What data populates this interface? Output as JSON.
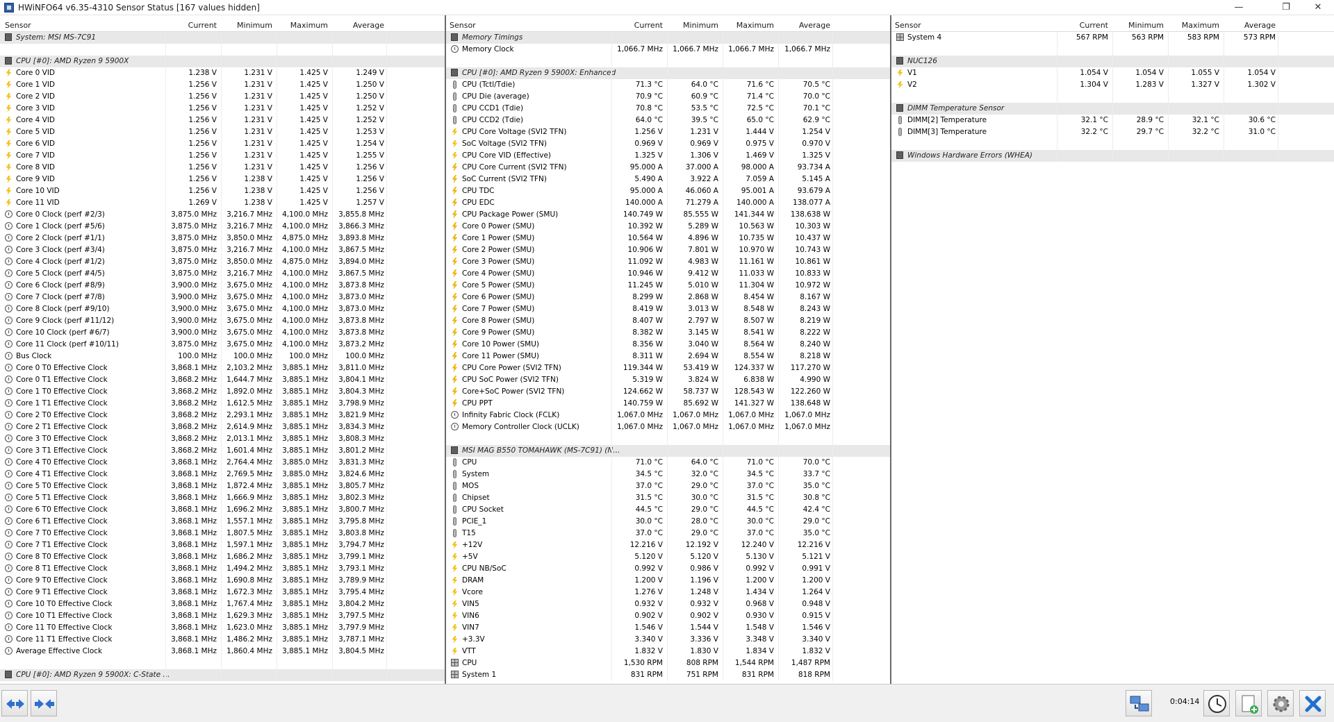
{
  "window": {
    "title": "HWiNFO64 v6.35-4310 Sensor Status [167 values hidden]",
    "min_glyph": "—",
    "restore_glyph": "❐",
    "close_glyph": "✕"
  },
  "columns": {
    "sensor": "Sensor",
    "current": "Current",
    "minimum": "Minimum",
    "maximum": "Maximum",
    "average": "Average"
  },
  "panel1": [
    {
      "g": "System: MSI MS-7C91",
      "i": "chip"
    },
    {
      "blank": true
    },
    {
      "g": "CPU [#0]: AMD Ryzen 9 5900X",
      "i": "chip"
    },
    {
      "n": "Core 0 VID",
      "i": "volt",
      "c": "1.238 V",
      "mn": "1.231 V",
      "mx": "1.425 V",
      "av": "1.249 V"
    },
    {
      "n": "Core 1 VID",
      "i": "volt",
      "c": "1.256 V",
      "mn": "1.231 V",
      "mx": "1.425 V",
      "av": "1.250 V"
    },
    {
      "n": "Core 2 VID",
      "i": "volt",
      "c": "1.256 V",
      "mn": "1.231 V",
      "mx": "1.425 V",
      "av": "1.250 V"
    },
    {
      "n": "Core 3 VID",
      "i": "volt",
      "c": "1.256 V",
      "mn": "1.231 V",
      "mx": "1.425 V",
      "av": "1.252 V"
    },
    {
      "n": "Core 4 VID",
      "i": "volt",
      "c": "1.256 V",
      "mn": "1.231 V",
      "mx": "1.425 V",
      "av": "1.252 V"
    },
    {
      "n": "Core 5 VID",
      "i": "volt",
      "c": "1.256 V",
      "mn": "1.231 V",
      "mx": "1.425 V",
      "av": "1.253 V"
    },
    {
      "n": "Core 6 VID",
      "i": "volt",
      "c": "1.256 V",
      "mn": "1.231 V",
      "mx": "1.425 V",
      "av": "1.254 V"
    },
    {
      "n": "Core 7 VID",
      "i": "volt",
      "c": "1.256 V",
      "mn": "1.231 V",
      "mx": "1.425 V",
      "av": "1.255 V"
    },
    {
      "n": "Core 8 VID",
      "i": "volt",
      "c": "1.256 V",
      "mn": "1.231 V",
      "mx": "1.425 V",
      "av": "1.256 V"
    },
    {
      "n": "Core 9 VID",
      "i": "volt",
      "c": "1.256 V",
      "mn": "1.238 V",
      "mx": "1.425 V",
      "av": "1.256 V"
    },
    {
      "n": "Core 10 VID",
      "i": "volt",
      "c": "1.256 V",
      "mn": "1.238 V",
      "mx": "1.425 V",
      "av": "1.256 V"
    },
    {
      "n": "Core 11 VID",
      "i": "volt",
      "c": "1.269 V",
      "mn": "1.238 V",
      "mx": "1.425 V",
      "av": "1.257 V"
    },
    {
      "n": "Core 0 Clock (perf #2/3)",
      "i": "clock",
      "c": "3,875.0 MHz",
      "mn": "3,216.7 MHz",
      "mx": "4,100.0 MHz",
      "av": "3,855.8 MHz"
    },
    {
      "n": "Core 1 Clock (perf #5/6)",
      "i": "clock",
      "c": "3,875.0 MHz",
      "mn": "3,216.7 MHz",
      "mx": "4,100.0 MHz",
      "av": "3,866.3 MHz"
    },
    {
      "n": "Core 2 Clock (perf #1/1)",
      "i": "clock",
      "c": "3,875.0 MHz",
      "mn": "3,850.0 MHz",
      "mx": "4,875.0 MHz",
      "av": "3,893.8 MHz"
    },
    {
      "n": "Core 3 Clock (perf #3/4)",
      "i": "clock",
      "c": "3,875.0 MHz",
      "mn": "3,216.7 MHz",
      "mx": "4,100.0 MHz",
      "av": "3,867.5 MHz"
    },
    {
      "n": "Core 4 Clock (perf #1/2)",
      "i": "clock",
      "c": "3,875.0 MHz",
      "mn": "3,850.0 MHz",
      "mx": "4,875.0 MHz",
      "av": "3,894.0 MHz"
    },
    {
      "n": "Core 5 Clock (perf #4/5)",
      "i": "clock",
      "c": "3,875.0 MHz",
      "mn": "3,216.7 MHz",
      "mx": "4,100.0 MHz",
      "av": "3,867.5 MHz"
    },
    {
      "n": "Core 6 Clock (perf #8/9)",
      "i": "clock",
      "c": "3,900.0 MHz",
      "mn": "3,675.0 MHz",
      "mx": "4,100.0 MHz",
      "av": "3,873.8 MHz"
    },
    {
      "n": "Core 7 Clock (perf #7/8)",
      "i": "clock",
      "c": "3,900.0 MHz",
      "mn": "3,675.0 MHz",
      "mx": "4,100.0 MHz",
      "av": "3,873.0 MHz"
    },
    {
      "n": "Core 8 Clock (perf #9/10)",
      "i": "clock",
      "c": "3,900.0 MHz",
      "mn": "3,675.0 MHz",
      "mx": "4,100.0 MHz",
      "av": "3,873.0 MHz"
    },
    {
      "n": "Core 9 Clock (perf #11/12)",
      "i": "clock",
      "c": "3,900.0 MHz",
      "mn": "3,675.0 MHz",
      "mx": "4,100.0 MHz",
      "av": "3,873.8 MHz"
    },
    {
      "n": "Core 10 Clock (perf #6/7)",
      "i": "clock",
      "c": "3,900.0 MHz",
      "mn": "3,675.0 MHz",
      "mx": "4,100.0 MHz",
      "av": "3,873.8 MHz"
    },
    {
      "n": "Core 11 Clock (perf #10/11)",
      "i": "clock",
      "c": "3,875.0 MHz",
      "mn": "3,675.0 MHz",
      "mx": "4,100.0 MHz",
      "av": "3,873.2 MHz"
    },
    {
      "n": "Bus Clock",
      "i": "clock",
      "c": "100.0 MHz",
      "mn": "100.0 MHz",
      "mx": "100.0 MHz",
      "av": "100.0 MHz"
    },
    {
      "n": "Core 0 T0 Effective Clock",
      "i": "clock",
      "c": "3,868.1 MHz",
      "mn": "2,103.2 MHz",
      "mx": "3,885.1 MHz",
      "av": "3,811.0 MHz"
    },
    {
      "n": "Core 0 T1 Effective Clock",
      "i": "clock",
      "c": "3,868.2 MHz",
      "mn": "1,644.7 MHz",
      "mx": "3,885.1 MHz",
      "av": "3,804.1 MHz"
    },
    {
      "n": "Core 1 T0 Effective Clock",
      "i": "clock",
      "c": "3,868.2 MHz",
      "mn": "1,892.0 MHz",
      "mx": "3,885.1 MHz",
      "av": "3,804.3 MHz"
    },
    {
      "n": "Core 1 T1 Effective Clock",
      "i": "clock",
      "c": "3,868.2 MHz",
      "mn": "1,612.5 MHz",
      "mx": "3,885.1 MHz",
      "av": "3,798.9 MHz"
    },
    {
      "n": "Core 2 T0 Effective Clock",
      "i": "clock",
      "c": "3,868.2 MHz",
      "mn": "2,293.1 MHz",
      "mx": "3,885.1 MHz",
      "av": "3,821.9 MHz"
    },
    {
      "n": "Core 2 T1 Effective Clock",
      "i": "clock",
      "c": "3,868.2 MHz",
      "mn": "2,614.9 MHz",
      "mx": "3,885.1 MHz",
      "av": "3,834.3 MHz"
    },
    {
      "n": "Core 3 T0 Effective Clock",
      "i": "clock",
      "c": "3,868.2 MHz",
      "mn": "2,013.1 MHz",
      "mx": "3,885.1 MHz",
      "av": "3,808.3 MHz"
    },
    {
      "n": "Core 3 T1 Effective Clock",
      "i": "clock",
      "c": "3,868.2 MHz",
      "mn": "1,601.4 MHz",
      "mx": "3,885.1 MHz",
      "av": "3,801.2 MHz"
    },
    {
      "n": "Core 4 T0 Effective Clock",
      "i": "clock",
      "c": "3,868.1 MHz",
      "mn": "2,764.4 MHz",
      "mx": "3,885.0 MHz",
      "av": "3,831.3 MHz"
    },
    {
      "n": "Core 4 T1 Effective Clock",
      "i": "clock",
      "c": "3,868.1 MHz",
      "mn": "2,769.5 MHz",
      "mx": "3,885.0 MHz",
      "av": "3,824.6 MHz"
    },
    {
      "n": "Core 5 T0 Effective Clock",
      "i": "clock",
      "c": "3,868.1 MHz",
      "mn": "1,872.4 MHz",
      "mx": "3,885.1 MHz",
      "av": "3,805.7 MHz"
    },
    {
      "n": "Core 5 T1 Effective Clock",
      "i": "clock",
      "c": "3,868.1 MHz",
      "mn": "1,666.9 MHz",
      "mx": "3,885.1 MHz",
      "av": "3,802.3 MHz"
    },
    {
      "n": "Core 6 T0 Effective Clock",
      "i": "clock",
      "c": "3,868.1 MHz",
      "mn": "1,696.2 MHz",
      "mx": "3,885.1 MHz",
      "av": "3,800.7 MHz"
    },
    {
      "n": "Core 6 T1 Effective Clock",
      "i": "clock",
      "c": "3,868.1 MHz",
      "mn": "1,557.1 MHz",
      "mx": "3,885.1 MHz",
      "av": "3,795.8 MHz"
    },
    {
      "n": "Core 7 T0 Effective Clock",
      "i": "clock",
      "c": "3,868.1 MHz",
      "mn": "1,807.5 MHz",
      "mx": "3,885.1 MHz",
      "av": "3,803.8 MHz"
    },
    {
      "n": "Core 7 T1 Effective Clock",
      "i": "clock",
      "c": "3,868.1 MHz",
      "mn": "1,597.1 MHz",
      "mx": "3,885.1 MHz",
      "av": "3,794.7 MHz"
    },
    {
      "n": "Core 8 T0 Effective Clock",
      "i": "clock",
      "c": "3,868.1 MHz",
      "mn": "1,686.2 MHz",
      "mx": "3,885.1 MHz",
      "av": "3,799.1 MHz"
    },
    {
      "n": "Core 8 T1 Effective Clock",
      "i": "clock",
      "c": "3,868.1 MHz",
      "mn": "1,494.2 MHz",
      "mx": "3,885.1 MHz",
      "av": "3,793.1 MHz"
    },
    {
      "n": "Core 9 T0 Effective Clock",
      "i": "clock",
      "c": "3,868.1 MHz",
      "mn": "1,690.8 MHz",
      "mx": "3,885.1 MHz",
      "av": "3,789.9 MHz"
    },
    {
      "n": "Core 9 T1 Effective Clock",
      "i": "clock",
      "c": "3,868.1 MHz",
      "mn": "1,672.3 MHz",
      "mx": "3,885.1 MHz",
      "av": "3,795.4 MHz"
    },
    {
      "n": "Core 10 T0 Effective Clock",
      "i": "clock",
      "c": "3,868.1 MHz",
      "mn": "1,767.4 MHz",
      "mx": "3,885.1 MHz",
      "av": "3,804.2 MHz"
    },
    {
      "n": "Core 10 T1 Effective Clock",
      "i": "clock",
      "c": "3,868.1 MHz",
      "mn": "1,629.3 MHz",
      "mx": "3,885.1 MHz",
      "av": "3,797.5 MHz"
    },
    {
      "n": "Core 11 T0 Effective Clock",
      "i": "clock",
      "c": "3,868.1 MHz",
      "mn": "1,623.0 MHz",
      "mx": "3,885.1 MHz",
      "av": "3,797.9 MHz"
    },
    {
      "n": "Core 11 T1 Effective Clock",
      "i": "clock",
      "c": "3,868.1 MHz",
      "mn": "1,486.2 MHz",
      "mx": "3,885.1 MHz",
      "av": "3,787.1 MHz"
    },
    {
      "n": "Average Effective Clock",
      "i": "clock",
      "c": "3,868.1 MHz",
      "mn": "1,860.4 MHz",
      "mx": "3,885.1 MHz",
      "av": "3,804.5 MHz"
    },
    {
      "blank": true
    },
    {
      "g": "CPU [#0]: AMD Ryzen 9 5900X: C-State ...",
      "i": "chip"
    }
  ],
  "panel2": [
    {
      "g": "Memory Timings",
      "i": "chip"
    },
    {
      "n": "Memory Clock",
      "i": "clock",
      "c": "1,066.7 MHz",
      "mn": "1,066.7 MHz",
      "mx": "1,066.7 MHz",
      "av": "1,066.7 MHz"
    },
    {
      "blank": true
    },
    {
      "g": "CPU [#0]: AMD Ryzen 9 5900X: Enhanced",
      "i": "chip"
    },
    {
      "n": "CPU (Tctl/Tdie)",
      "i": "temp",
      "c": "71.3 °C",
      "mn": "64.0 °C",
      "mx": "71.6 °C",
      "av": "70.5 °C"
    },
    {
      "n": "CPU Die (average)",
      "i": "temp",
      "c": "70.9 °C",
      "mn": "60.9 °C",
      "mx": "71.4 °C",
      "av": "70.0 °C"
    },
    {
      "n": "CPU CCD1 (Tdie)",
      "i": "temp",
      "c": "70.8 °C",
      "mn": "53.5 °C",
      "mx": "72.5 °C",
      "av": "70.1 °C"
    },
    {
      "n": "CPU CCD2 (Tdie)",
      "i": "temp",
      "c": "64.0 °C",
      "mn": "39.5 °C",
      "mx": "65.0 °C",
      "av": "62.9 °C"
    },
    {
      "n": "CPU Core Voltage (SVI2 TFN)",
      "i": "volt",
      "c": "1.256 V",
      "mn": "1.231 V",
      "mx": "1.444 V",
      "av": "1.254 V"
    },
    {
      "n": "SoC Voltage (SVI2 TFN)",
      "i": "volt",
      "c": "0.969 V",
      "mn": "0.969 V",
      "mx": "0.975 V",
      "av": "0.970 V"
    },
    {
      "n": "CPU Core VID (Effective)",
      "i": "volt",
      "c": "1.325 V",
      "mn": "1.306 V",
      "mx": "1.469 V",
      "av": "1.325 V"
    },
    {
      "n": "CPU Core Current (SVI2 TFN)",
      "i": "current",
      "c": "95.000 A",
      "mn": "37.000 A",
      "mx": "98.000 A",
      "av": "93.734 A"
    },
    {
      "n": "SoC Current (SVI2 TFN)",
      "i": "current",
      "c": "5.490 A",
      "mn": "3.922 A",
      "mx": "7.059 A",
      "av": "5.145 A"
    },
    {
      "n": "CPU TDC",
      "i": "current",
      "c": "95.000 A",
      "mn": "46.060 A",
      "mx": "95.001 A",
      "av": "93.679 A"
    },
    {
      "n": "CPU EDC",
      "i": "current",
      "c": "140.000 A",
      "mn": "71.279 A",
      "mx": "140.000 A",
      "av": "138.077 A"
    },
    {
      "n": "CPU Package Power (SMU)",
      "i": "power",
      "c": "140.749 W",
      "mn": "85.555 W",
      "mx": "141.344 W",
      "av": "138.638 W"
    },
    {
      "n": "Core 0 Power (SMU)",
      "i": "power",
      "c": "10.392 W",
      "mn": "5.289 W",
      "mx": "10.563 W",
      "av": "10.303 W"
    },
    {
      "n": "Core 1 Power (SMU)",
      "i": "power",
      "c": "10.564 W",
      "mn": "4.896 W",
      "mx": "10.735 W",
      "av": "10.437 W"
    },
    {
      "n": "Core 2 Power (SMU)",
      "i": "power",
      "c": "10.906 W",
      "mn": "7.801 W",
      "mx": "10.970 W",
      "av": "10.743 W"
    },
    {
      "n": "Core 3 Power (SMU)",
      "i": "power",
      "c": "11.092 W",
      "mn": "4.983 W",
      "mx": "11.161 W",
      "av": "10.861 W"
    },
    {
      "n": "Core 4 Power (SMU)",
      "i": "power",
      "c": "10.946 W",
      "mn": "9.412 W",
      "mx": "11.033 W",
      "av": "10.833 W"
    },
    {
      "n": "Core 5 Power (SMU)",
      "i": "power",
      "c": "11.245 W",
      "mn": "5.010 W",
      "mx": "11.304 W",
      "av": "10.972 W"
    },
    {
      "n": "Core 6 Power (SMU)",
      "i": "power",
      "c": "8.299 W",
      "mn": "2.868 W",
      "mx": "8.454 W",
      "av": "8.167 W"
    },
    {
      "n": "Core 7 Power (SMU)",
      "i": "power",
      "c": "8.419 W",
      "mn": "3.013 W",
      "mx": "8.548 W",
      "av": "8.243 W"
    },
    {
      "n": "Core 8 Power (SMU)",
      "i": "power",
      "c": "8.407 W",
      "mn": "2.797 W",
      "mx": "8.507 W",
      "av": "8.219 W"
    },
    {
      "n": "Core 9 Power (SMU)",
      "i": "power",
      "c": "8.382 W",
      "mn": "3.145 W",
      "mx": "8.541 W",
      "av": "8.222 W"
    },
    {
      "n": "Core 10 Power (SMU)",
      "i": "power",
      "c": "8.356 W",
      "mn": "3.040 W",
      "mx": "8.564 W",
      "av": "8.240 W"
    },
    {
      "n": "Core 11 Power (SMU)",
      "i": "power",
      "c": "8.311 W",
      "mn": "2.694 W",
      "mx": "8.554 W",
      "av": "8.218 W"
    },
    {
      "n": "CPU Core Power (SVI2 TFN)",
      "i": "power",
      "c": "119.344 W",
      "mn": "53.419 W",
      "mx": "124.337 W",
      "av": "117.270 W"
    },
    {
      "n": "CPU SoC Power (SVI2 TFN)",
      "i": "power",
      "c": "5.319 W",
      "mn": "3.824 W",
      "mx": "6.838 W",
      "av": "4.990 W"
    },
    {
      "n": "Core+SoC Power (SVI2 TFN)",
      "i": "power",
      "c": "124.662 W",
      "mn": "58.737 W",
      "mx": "128.543 W",
      "av": "122.260 W"
    },
    {
      "n": "CPU PPT",
      "i": "power",
      "c": "140.759 W",
      "mn": "85.692 W",
      "mx": "141.327 W",
      "av": "138.648 W"
    },
    {
      "n": "Infinity Fabric Clock (FCLK)",
      "i": "clock",
      "c": "1,067.0 MHz",
      "mn": "1,067.0 MHz",
      "mx": "1,067.0 MHz",
      "av": "1,067.0 MHz"
    },
    {
      "n": "Memory Controller Clock (UCLK)",
      "i": "clock",
      "c": "1,067.0 MHz",
      "mn": "1,067.0 MHz",
      "mx": "1,067.0 MHz",
      "av": "1,067.0 MHz"
    },
    {
      "blank": true
    },
    {
      "g": "MSI MAG B550 TOMAHAWK (MS-7C91) (N...",
      "i": "chip"
    },
    {
      "n": "CPU",
      "i": "temp",
      "c": "71.0 °C",
      "mn": "64.0 °C",
      "mx": "71.0 °C",
      "av": "70.0 °C"
    },
    {
      "n": "System",
      "i": "temp",
      "c": "34.5 °C",
      "mn": "32.0 °C",
      "mx": "34.5 °C",
      "av": "33.7 °C"
    },
    {
      "n": "MOS",
      "i": "temp",
      "c": "37.0 °C",
      "mn": "29.0 °C",
      "mx": "37.0 °C",
      "av": "35.0 °C"
    },
    {
      "n": "Chipset",
      "i": "temp",
      "c": "31.5 °C",
      "mn": "30.0 °C",
      "mx": "31.5 °C",
      "av": "30.8 °C"
    },
    {
      "n": "CPU Socket",
      "i": "temp",
      "c": "44.5 °C",
      "mn": "29.0 °C",
      "mx": "44.5 °C",
      "av": "42.4 °C"
    },
    {
      "n": "PCIE_1",
      "i": "temp",
      "c": "30.0 °C",
      "mn": "28.0 °C",
      "mx": "30.0 °C",
      "av": "29.0 °C"
    },
    {
      "n": "T15",
      "i": "temp",
      "c": "37.0 °C",
      "mn": "29.0 °C",
      "mx": "37.0 °C",
      "av": "35.0 °C"
    },
    {
      "n": "+12V",
      "i": "volt",
      "c": "12.216 V",
      "mn": "12.192 V",
      "mx": "12.240 V",
      "av": "12.216 V"
    },
    {
      "n": "+5V",
      "i": "volt",
      "c": "5.120 V",
      "mn": "5.120 V",
      "mx": "5.130 V",
      "av": "5.121 V"
    },
    {
      "n": "CPU NB/SoC",
      "i": "volt",
      "c": "0.992 V",
      "mn": "0.986 V",
      "mx": "0.992 V",
      "av": "0.991 V"
    },
    {
      "n": "DRAM",
      "i": "volt",
      "c": "1.200 V",
      "mn": "1.196 V",
      "mx": "1.200 V",
      "av": "1.200 V"
    },
    {
      "n": "Vcore",
      "i": "volt",
      "c": "1.276 V",
      "mn": "1.248 V",
      "mx": "1.434 V",
      "av": "1.264 V"
    },
    {
      "n": "VIN5",
      "i": "volt",
      "c": "0.932 V",
      "mn": "0.932 V",
      "mx": "0.968 V",
      "av": "0.948 V"
    },
    {
      "n": "VIN6",
      "i": "volt",
      "c": "0.902 V",
      "mn": "0.902 V",
      "mx": "0.930 V",
      "av": "0.915 V"
    },
    {
      "n": "VIN7",
      "i": "volt",
      "c": "1.546 V",
      "mn": "1.544 V",
      "mx": "1.548 V",
      "av": "1.546 V"
    },
    {
      "n": "+3.3V",
      "i": "volt",
      "c": "3.340 V",
      "mn": "3.336 V",
      "mx": "3.348 V",
      "av": "3.340 V"
    },
    {
      "n": "VTT",
      "i": "volt",
      "c": "1.832 V",
      "mn": "1.830 V",
      "mx": "1.834 V",
      "av": "1.832 V"
    },
    {
      "n": "CPU",
      "i": "fan",
      "c": "1,530 RPM",
      "mn": "808 RPM",
      "mx": "1,544 RPM",
      "av": "1,487 RPM"
    },
    {
      "n": "System 1",
      "i": "fan",
      "c": "831 RPM",
      "mn": "751 RPM",
      "mx": "831 RPM",
      "av": "818 RPM"
    }
  ],
  "panel3": [
    {
      "n": "System 4",
      "i": "fan",
      "c": "567 RPM",
      "mn": "563 RPM",
      "mx": "583 RPM",
      "av": "573 RPM"
    },
    {
      "blank": true
    },
    {
      "g": "NUC126",
      "i": "chip"
    },
    {
      "n": "V1",
      "i": "volt",
      "c": "1.054 V",
      "mn": "1.054 V",
      "mx": "1.055 V",
      "av": "1.054 V"
    },
    {
      "n": "V2",
      "i": "volt",
      "c": "1.304 V",
      "mn": "1.283 V",
      "mx": "1.327 V",
      "av": "1.302 V"
    },
    {
      "blank": true
    },
    {
      "g": "DIMM Temperature Sensor",
      "i": "chip"
    },
    {
      "n": "DIMM[2] Temperature",
      "i": "temp",
      "c": "32.1 °C",
      "mn": "28.9 °C",
      "mx": "32.1 °C",
      "av": "30.6 °C"
    },
    {
      "n": "DIMM[3] Temperature",
      "i": "temp",
      "c": "32.2 °C",
      "mn": "29.7 °C",
      "mx": "32.2 °C",
      "av": "31.0 °C"
    },
    {
      "blank": true
    },
    {
      "g": "Windows Hardware Errors (WHEA)",
      "i": "chip"
    }
  ],
  "statusbar": {
    "timer": "0:04:14"
  }
}
